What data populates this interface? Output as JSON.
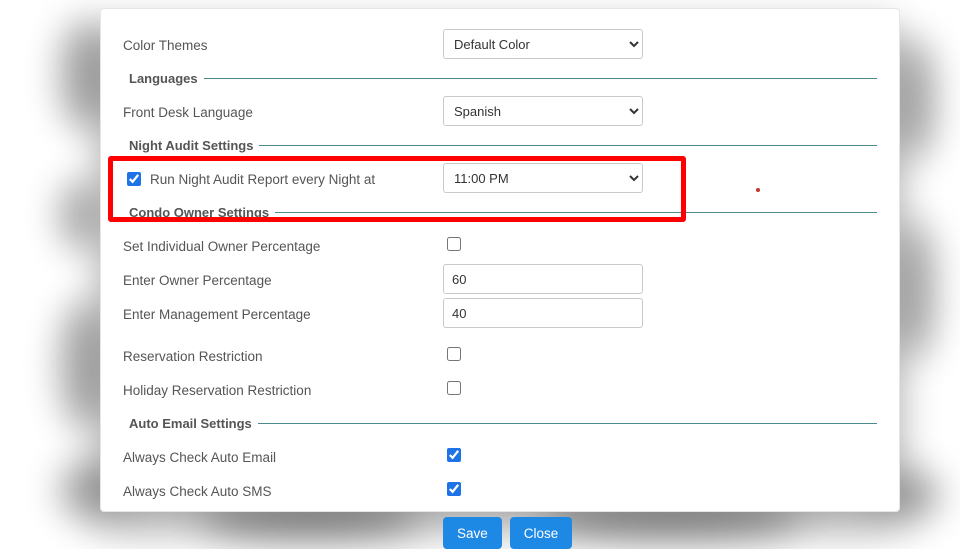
{
  "themes": {
    "label": "Color Themes",
    "value": "Default Color"
  },
  "languages": {
    "legend": "Languages",
    "label": "Front Desk Language",
    "value": "Spanish"
  },
  "nightAudit": {
    "legend": "Night Audit Settings",
    "checkLabel": "Run Night Audit Report every Night at",
    "checked": true,
    "time": "11:00 PM"
  },
  "condo": {
    "legend": "Condo Owner Settings",
    "setIndividual": {
      "label": "Set Individual Owner Percentage",
      "checked": false
    },
    "ownerPct": {
      "label": "Enter Owner Percentage",
      "value": "60"
    },
    "mgmtPct": {
      "label": "Enter Management Percentage",
      "value": "40"
    },
    "resRestrict": {
      "label": "Reservation Restriction",
      "checked": false
    },
    "holRestrict": {
      "label": "Holiday Reservation Restriction",
      "checked": false
    }
  },
  "autoEmail": {
    "legend": "Auto Email Settings",
    "email": {
      "label": "Always Check Auto Email",
      "checked": true
    },
    "sms": {
      "label": "Always Check Auto SMS",
      "checked": true
    }
  },
  "buttons": {
    "save": "Save",
    "close": "Close"
  }
}
